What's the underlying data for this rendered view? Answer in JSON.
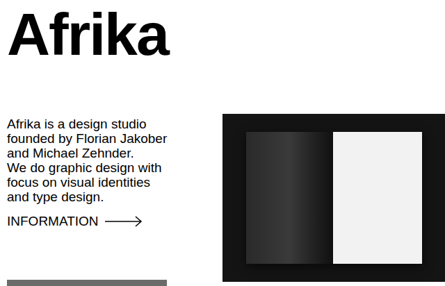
{
  "header": {
    "logo": "Afrika"
  },
  "intro": {
    "lines": [
      "Afrika is a design studio",
      "founded by Florian Jakober",
      "and Michael Zehnder.",
      "We do graphic design with",
      "focus on visual identities",
      "and type design."
    ]
  },
  "link": {
    "label": "INFORMATION"
  }
}
